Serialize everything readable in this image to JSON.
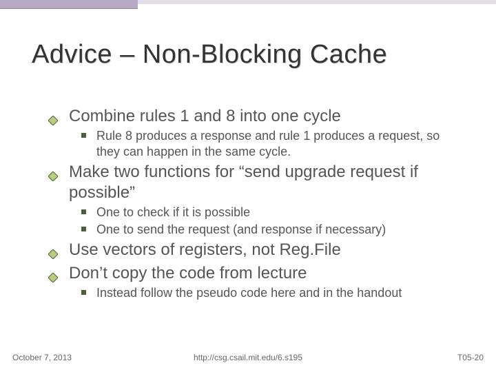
{
  "title": "Advice – Non-Blocking Cache",
  "bullets": {
    "b1": "Combine rules 1 and 8 into one cycle",
    "b1_1": "Rule 8 produces a response and rule 1 produces a request, so they can happen in the same cycle.",
    "b2": "Make two functions for “send upgrade request if possible”",
    "b2_1": "One to check if it is possible",
    "b2_2": "One to send the request (and response if necessary)",
    "b3": "Use vectors of registers, not Reg.File",
    "b4": "Don’t copy the code from lecture",
    "b4_1": "Instead follow the pseudo code here and in the handout"
  },
  "footer": {
    "date": "October 7, 2013",
    "url": "http://csg.csail.mit.edu/6.s195",
    "slide": "T05-20"
  }
}
